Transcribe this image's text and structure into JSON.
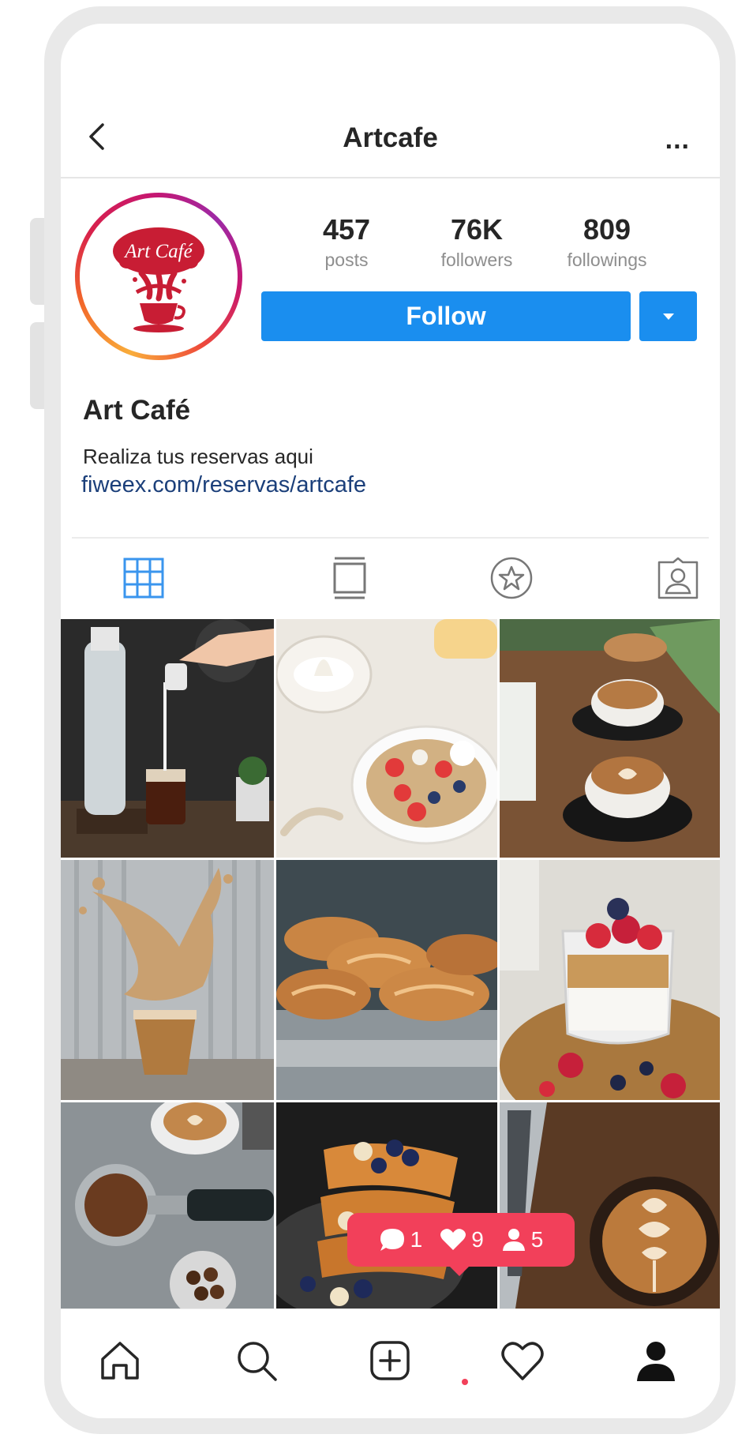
{
  "header": {
    "title": "Artcafe",
    "more_label": "..."
  },
  "profile": {
    "logo_text": "Art Café",
    "stats": [
      {
        "value": "457",
        "label": "posts"
      },
      {
        "value": "76K",
        "label": "followers"
      },
      {
        "value": "809",
        "label": "followings"
      }
    ],
    "follow_label": "Follow",
    "name": "Art Café",
    "bio": "Realiza tus reservas aqui",
    "link": "fiweex.com/reservas/artcafe"
  },
  "tabs": [
    {
      "icon": "grid-icon",
      "active": true
    },
    {
      "icon": "feed-icon",
      "active": false
    },
    {
      "icon": "star-icon",
      "active": false
    },
    {
      "icon": "tagged-icon",
      "active": false
    }
  ],
  "posts": [
    {
      "subject": "milk pouring into cold brew bottle"
    },
    {
      "subject": "yogurt bowl with berries"
    },
    {
      "subject": "latte art cups"
    },
    {
      "subject": "iced coffee splash"
    },
    {
      "subject": "croissants on tray"
    },
    {
      "subject": "yogurt parfait with berries"
    },
    {
      "subject": "espresso portafilter and beans"
    },
    {
      "subject": "french toast with berries"
    },
    {
      "subject": "latte art near laptop"
    }
  ],
  "notification": {
    "comments": "1",
    "likes": "9",
    "follows": "5"
  },
  "bottom_nav": [
    "home-icon",
    "search-icon",
    "add-post-icon",
    "activity-icon",
    "profile-icon"
  ],
  "colors": {
    "accent": "#1a8eef",
    "notification": "#f2405a",
    "link": "#1b3f7a",
    "logo": "#c81d34"
  }
}
